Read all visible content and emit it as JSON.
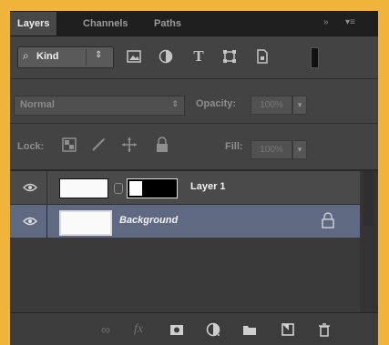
{
  "tabs": [
    {
      "label": "Layers",
      "active": true
    },
    {
      "label": "Channels",
      "active": false
    },
    {
      "label": "Paths",
      "active": false
    }
  ],
  "panel_controls": {
    "collapse": "»",
    "menu": "▾≡"
  },
  "filter": {
    "kind_label": "Kind",
    "kind_glyph": "⌕",
    "kind_arrow": "⇕",
    "icons": [
      "image-filter-icon",
      "adjustment-filter-icon",
      "type-filter-icon",
      "shape-filter-icon",
      "smart-object-filter-icon"
    ],
    "type_glyph": "T"
  },
  "blend": {
    "mode": "Normal",
    "arrow": "⇕",
    "opacity_label": "Opacity:",
    "opacity_value": "100%",
    "dropdown_arrow": "▾"
  },
  "lock": {
    "label": "Lock:",
    "fill_label": "Fill:",
    "fill_value": "100%",
    "dropdown_arrow": "▾"
  },
  "layers": [
    {
      "name": "Layer 1",
      "visible": true,
      "selected": false,
      "has_mask": true
    },
    {
      "name": "Background",
      "visible": true,
      "selected": true,
      "locked": true
    }
  ],
  "bottom_icons": [
    "link-layers-icon",
    "fx-icon",
    "add-mask-icon",
    "adjustment-layer-icon",
    "new-group-icon",
    "new-layer-icon",
    "delete-icon"
  ],
  "bottom_glyphs": {
    "link": "∞",
    "fx": "fx",
    "mask": "◘",
    "adjustment": "◐",
    "group": "▬",
    "new": "▣",
    "delete": "🗑"
  },
  "colors": {
    "accent_selected": "#5f6981",
    "frame": "#f0b43a"
  }
}
